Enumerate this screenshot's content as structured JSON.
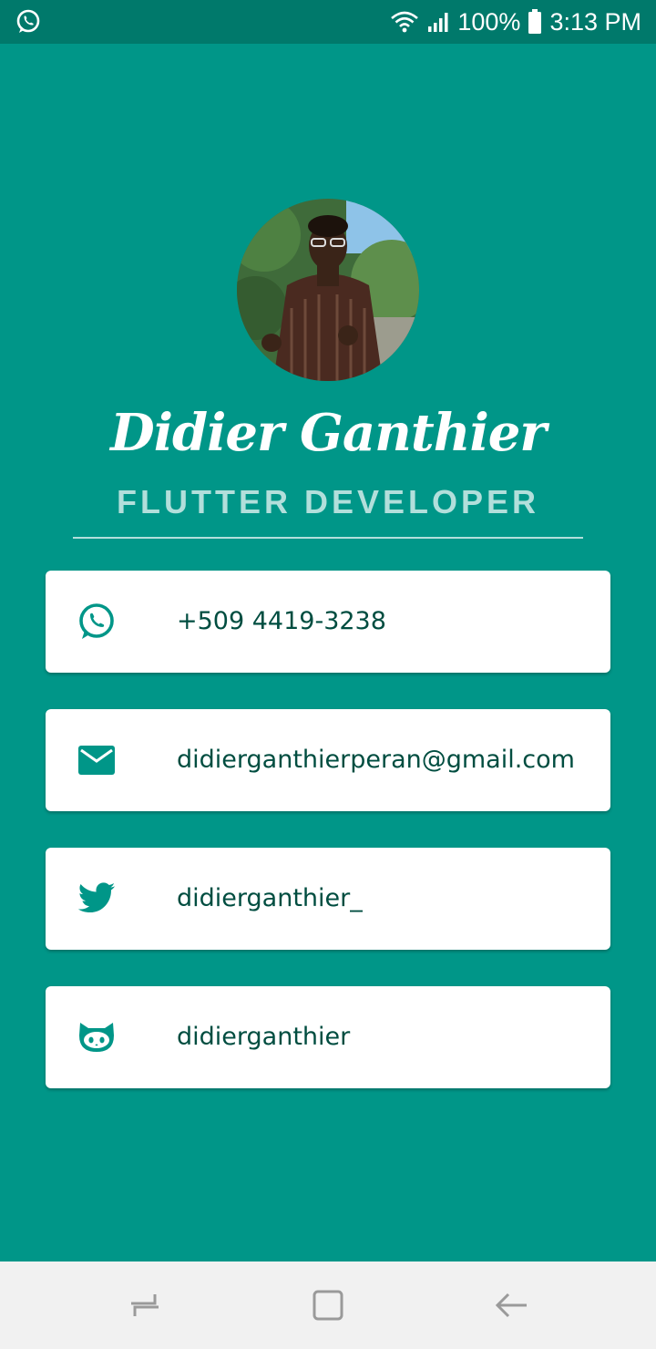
{
  "status_bar": {
    "battery": "100%",
    "time": "3:13 PM",
    "left_icon": "whatsapp-icon",
    "wifi_icon": "wifi-icon",
    "signal_icon": "signal-icon",
    "battery_icon": "battery-icon"
  },
  "profile": {
    "name": "Didier Ganthier",
    "title": "FLUTTER DEVELOPER",
    "avatar": "profile-photo"
  },
  "contacts": [
    {
      "icon": "whatsapp-icon",
      "text": "+509 4419-3238"
    },
    {
      "icon": "email-icon",
      "text": "didierganthierperan@gmail.com"
    },
    {
      "icon": "twitter-icon",
      "text": "didierganthier_"
    },
    {
      "icon": "github-icon",
      "text": "didierganthier"
    }
  ],
  "navigation": {
    "recents_icon": "recents-icon",
    "home_icon": "home-icon",
    "back_icon": "back-icon"
  },
  "colors": {
    "background": "#009688",
    "status_bar": "#00796B",
    "accent_text": "#B2DFDB",
    "card_text": "#004D40",
    "icon": "#009688",
    "nav_bar": "#F1F1F1"
  }
}
